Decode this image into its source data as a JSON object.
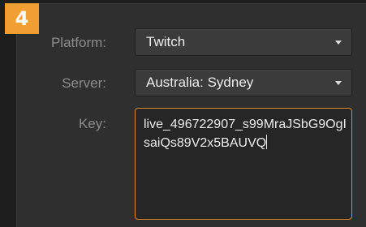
{
  "step": {
    "number": "4"
  },
  "form": {
    "platform": {
      "label": "Platform:",
      "value": "Twitch",
      "icon": "chevron-down-icon"
    },
    "server": {
      "label": "Server:",
      "value": "Australia: Sydney",
      "icon": "chevron-down-icon"
    },
    "key": {
      "label": "Key:",
      "value": "live_496722907_s99MraJSbG9OgIsaiQs89V2x5BAUVQ"
    }
  },
  "colors": {
    "badge": "#f0a033",
    "focus_border": "#d9892f",
    "panel": "#2f2f2f",
    "label_text": "#8c8c8c",
    "field_text": "#ececec"
  }
}
